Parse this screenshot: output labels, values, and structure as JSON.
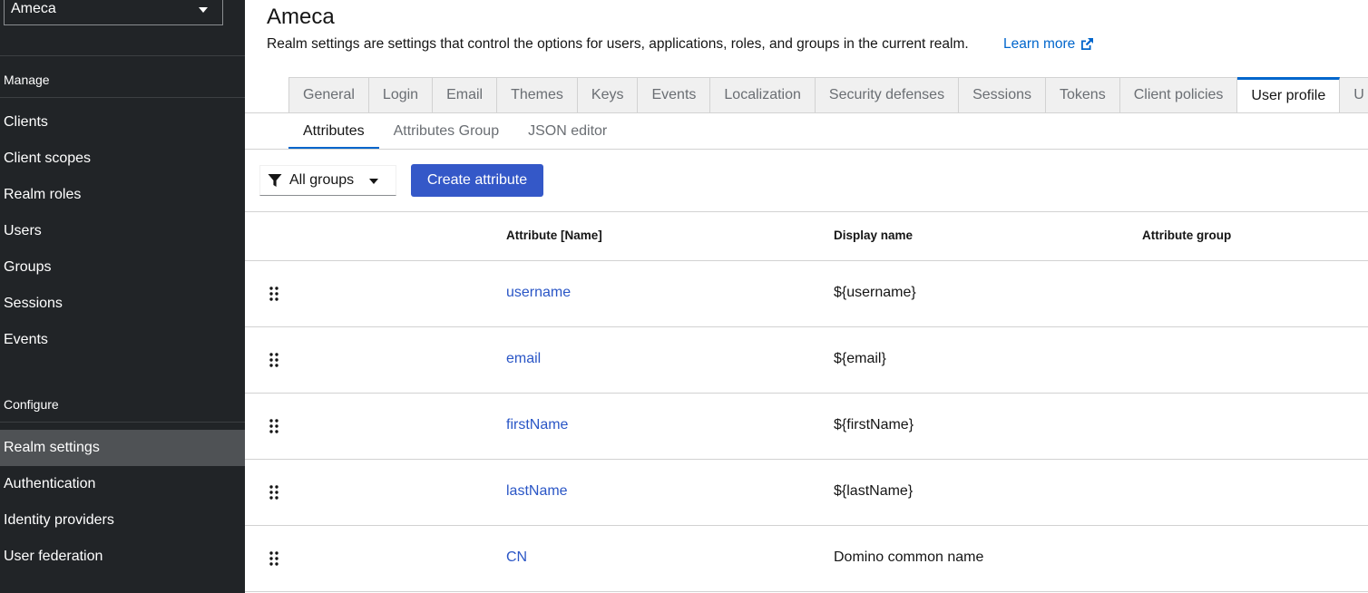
{
  "sidebar": {
    "realm_selector": "Ameca",
    "sections": [
      {
        "title": "Manage",
        "items": [
          {
            "label": "Clients",
            "active": false
          },
          {
            "label": "Client scopes",
            "active": false
          },
          {
            "label": "Realm roles",
            "active": false
          },
          {
            "label": "Users",
            "active": false
          },
          {
            "label": "Groups",
            "active": false
          },
          {
            "label": "Sessions",
            "active": false
          },
          {
            "label": "Events",
            "active": false
          }
        ]
      },
      {
        "title": "Configure",
        "items": [
          {
            "label": "Realm settings",
            "active": true
          },
          {
            "label": "Authentication",
            "active": false
          },
          {
            "label": "Identity providers",
            "active": false
          },
          {
            "label": "User federation",
            "active": false
          }
        ]
      }
    ]
  },
  "header": {
    "title": "Ameca",
    "description": "Realm settings are settings that control the options for users, applications, roles, and groups in the current realm.",
    "learn_more": "Learn more"
  },
  "tabs": [
    {
      "label": "General",
      "active": false
    },
    {
      "label": "Login",
      "active": false
    },
    {
      "label": "Email",
      "active": false
    },
    {
      "label": "Themes",
      "active": false
    },
    {
      "label": "Keys",
      "active": false
    },
    {
      "label": "Events",
      "active": false
    },
    {
      "label": "Localization",
      "active": false
    },
    {
      "label": "Security defenses",
      "active": false
    },
    {
      "label": "Sessions",
      "active": false
    },
    {
      "label": "Tokens",
      "active": false
    },
    {
      "label": "Client policies",
      "active": false
    },
    {
      "label": "User profile",
      "active": true
    },
    {
      "label": "U",
      "active": false
    }
  ],
  "subtabs": [
    {
      "label": "Attributes",
      "active": true
    },
    {
      "label": "Attributes Group",
      "active": false
    },
    {
      "label": "JSON editor",
      "active": false
    }
  ],
  "toolbar": {
    "filter_value": "All groups",
    "create_label": "Create attribute"
  },
  "table": {
    "columns": [
      "Attribute [Name]",
      "Display name",
      "Attribute group"
    ],
    "rows": [
      {
        "name": "username",
        "display_name": "${username}",
        "group": ""
      },
      {
        "name": "email",
        "display_name": "${email}",
        "group": ""
      },
      {
        "name": "firstName",
        "display_name": "${firstName}",
        "group": ""
      },
      {
        "name": "lastName",
        "display_name": "${lastName}",
        "group": ""
      },
      {
        "name": "CN",
        "display_name": "Domino common name",
        "group": ""
      }
    ]
  },
  "colors": {
    "sidebar_bg": "#212427",
    "sidebar_active": "#4f5255",
    "primary": "#3458c8",
    "link": "#2a56c6",
    "tab_active_border": "#0066cc"
  },
  "icons": {
    "realm_caret": "caret-down-icon",
    "learn_more": "external-link-icon",
    "filter": "filter-icon",
    "drag": "drag-handle-icon"
  }
}
